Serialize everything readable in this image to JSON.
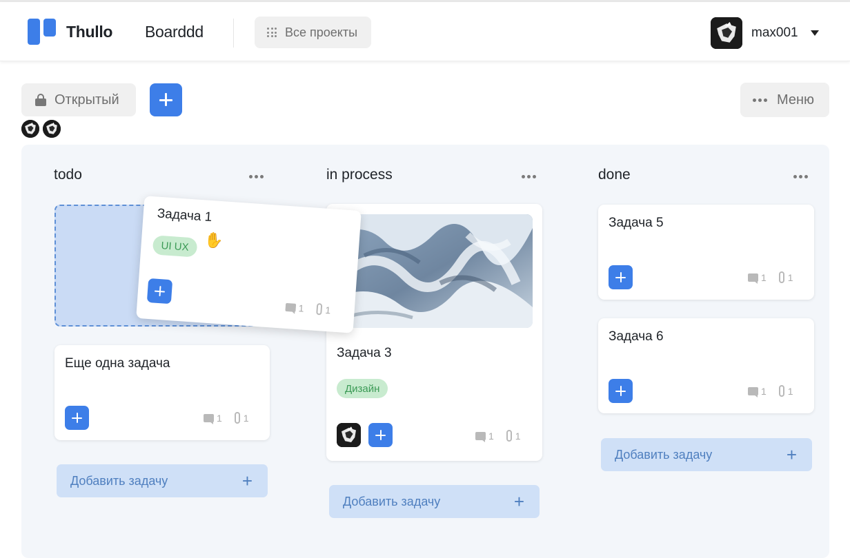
{
  "header": {
    "app_name": "Thullo",
    "board_name": "Boarddd",
    "all_projects_label": "Все проекты",
    "username": "max001"
  },
  "toolbar": {
    "visibility_label": "Открытый",
    "menu_label": "Меню"
  },
  "columns": [
    {
      "title": "todo",
      "cards": [
        {
          "title": "Задача 1",
          "tag": "UI UX",
          "comments": "1",
          "attachments": "1",
          "state": "dragging"
        },
        {
          "title": "Еще одна задача",
          "comments": "1",
          "attachments": "1"
        }
      ],
      "add_label": "Добавить задачу"
    },
    {
      "title": "in process",
      "cards": [
        {
          "title": "Задача 3",
          "tag": "Дизайн",
          "comments": "1",
          "attachments": "1",
          "has_image": true
        }
      ],
      "add_label": "Добавить задачу"
    },
    {
      "title": "done",
      "cards": [
        {
          "title": "Задача 5",
          "comments": "1",
          "attachments": "1"
        },
        {
          "title": "Задача 6",
          "comments": "1",
          "attachments": "1"
        }
      ],
      "add_label": "Добавить задачу"
    }
  ],
  "colors": {
    "accent": "#3d7ee8",
    "board_bg": "#f3f6fa",
    "add_task_bg": "#cfe0f7",
    "tag_bg": "#c8ebcf",
    "tag_text": "#3b9a55"
  },
  "icons": {
    "cursor": "✋"
  }
}
